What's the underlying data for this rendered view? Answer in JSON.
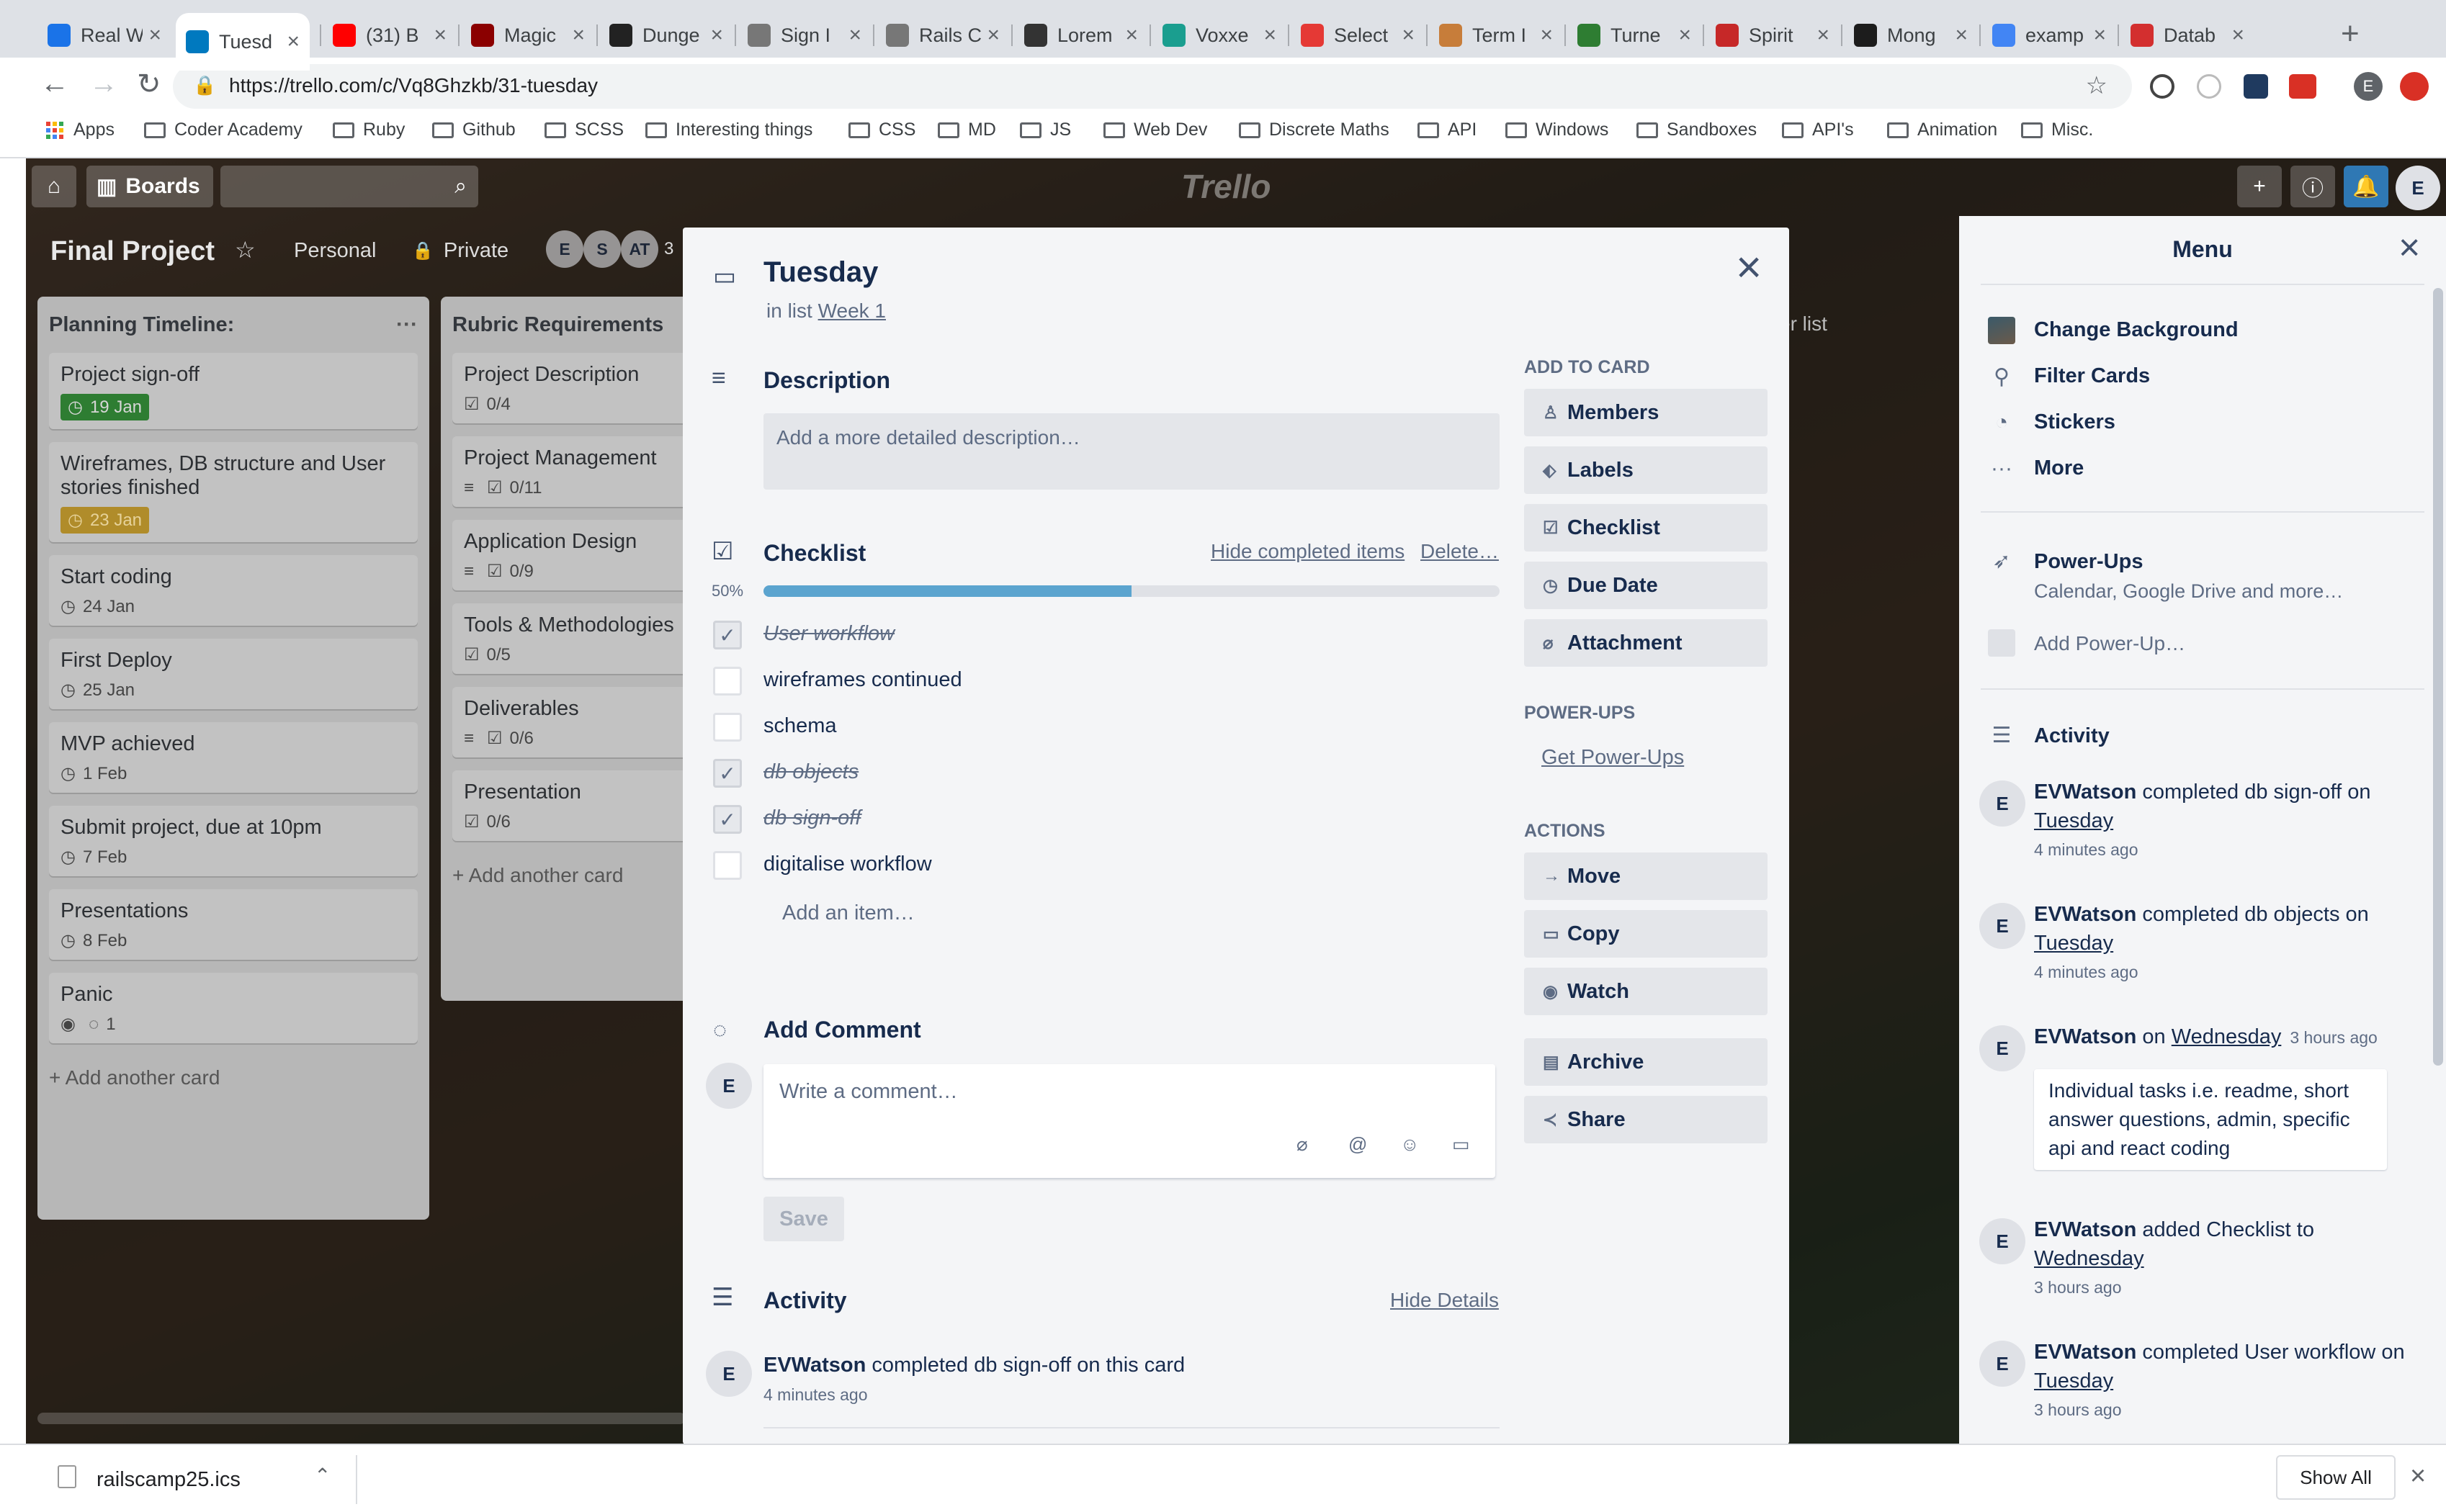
{
  "browser": {
    "tabs": [
      {
        "title": "Real W",
        "color": "#1a73e8"
      },
      {
        "title": "Tuesd",
        "color": "#0079bf",
        "active": true
      },
      {
        "title": "(31) B",
        "color": "#ff0000"
      },
      {
        "title": "Magic",
        "color": "#8b0000"
      },
      {
        "title": "Dunge",
        "color": "#222222"
      },
      {
        "title": "Sign I",
        "color": "#777777"
      },
      {
        "title": "Rails C",
        "color": "#777777"
      },
      {
        "title": "Lorem",
        "color": "#333333"
      },
      {
        "title": "Voxxe",
        "color": "#1a9e8f"
      },
      {
        "title": "Select",
        "color": "#e53935"
      },
      {
        "title": "Term I",
        "color": "#c77d3a"
      },
      {
        "title": "Turne",
        "color": "#2e7d32"
      },
      {
        "title": "Spirit",
        "color": "#c62828"
      },
      {
        "title": "Mong",
        "color": "#1c1c1c"
      },
      {
        "title": "examp",
        "color": "#4285f4"
      },
      {
        "title": "Datab",
        "color": "#d32f2f"
      }
    ],
    "url": "https://trello.com/c/Vq8Ghzkb/31-tuesday",
    "bookmarks": [
      "Apps",
      "Coder Academy",
      "Ruby",
      "Github",
      "SCSS",
      "Interesting things",
      "CSS",
      "MD",
      "JS",
      "Web Dev",
      "Discrete Maths",
      "API",
      "Windows",
      "Sandboxes",
      "API's",
      "Animation",
      "Misc."
    ],
    "profile_initial": "E"
  },
  "trello_header": {
    "boards_label": "Boards",
    "logo": "Trello",
    "user_initial": "E"
  },
  "board": {
    "title": "Final Project",
    "visibility_team": "Personal",
    "visibility": "Private",
    "members": [
      "E",
      "S",
      "AT"
    ],
    "member_overflow": "3",
    "add_list_partial": "er list",
    "lists": [
      {
        "title": "Planning Timeline:",
        "menu": "···",
        "cards": [
          {
            "title": "Project sign-off",
            "due": "19 Jan",
            "due_style": "done"
          },
          {
            "title": "Wireframes, DB structure and User stories finished",
            "due": "23 Jan",
            "due_style": "warn"
          },
          {
            "title": "Start coding",
            "due": "24 Jan"
          },
          {
            "title": "First Deploy",
            "due": "25 Jan"
          },
          {
            "title": "MVP achieved",
            "due": "1 Feb"
          },
          {
            "title": "Submit project, due at 10pm",
            "due": "7 Feb"
          },
          {
            "title": "Presentations",
            "due": "8 Feb"
          },
          {
            "title": "Panic",
            "comments": "1"
          }
        ],
        "add": "+ Add another card"
      },
      {
        "title": "Rubric Requirements",
        "cards": [
          {
            "title": "Project Description",
            "checklist": "0/4"
          },
          {
            "title": "Project Management",
            "checklist": "0/11"
          },
          {
            "title": "Application Design",
            "checklist": "0/9"
          },
          {
            "title": "Tools & Methodologies",
            "checklist": "0/5"
          },
          {
            "title": "Deliverables",
            "checklist": "0/6"
          },
          {
            "title": "Presentation",
            "checklist": "0/6"
          }
        ],
        "add": "+ Add another card"
      }
    ]
  },
  "card_modal": {
    "title": "Tuesday",
    "in_list_prefix": "in list",
    "list_name": "Week 1",
    "close": "×",
    "description": {
      "heading": "Description",
      "placeholder": "Add a more detailed description…"
    },
    "checklist": {
      "heading": "Checklist",
      "hide_completed": "Hide completed items",
      "delete": "Delete…",
      "percent_label": "50%",
      "progress": 0.5,
      "items": [
        {
          "text": "User workflow",
          "done": true
        },
        {
          "text": "wireframes continued",
          "done": false
        },
        {
          "text": "schema",
          "done": false
        },
        {
          "text": "db objects",
          "done": true
        },
        {
          "text": "db sign-off",
          "done": true
        },
        {
          "text": "digitalise workflow",
          "done": false
        }
      ],
      "add_item": "Add an item…"
    },
    "comment": {
      "heading": "Add Comment",
      "avatar": "E",
      "placeholder": "Write a comment…",
      "save": "Save"
    },
    "activity": {
      "heading": "Activity",
      "hide_details": "Hide Details",
      "entries": [
        {
          "user": "EVWatson",
          "text": "completed db sign-off on this card",
          "time": "4 minutes ago",
          "avatar": "E"
        }
      ]
    },
    "sidebar": {
      "add_to_card_heading": "ADD TO CARD",
      "add_to_card": [
        "Members",
        "Labels",
        "Checklist",
        "Due Date",
        "Attachment"
      ],
      "powerups_heading": "POWER-UPS",
      "get_powerups": "Get Power-Ups",
      "actions_heading": "ACTIONS",
      "actions": [
        "Move",
        "Copy",
        "Watch",
        "Archive",
        "Share"
      ]
    }
  },
  "menu": {
    "title": "Menu",
    "close": "×",
    "items": [
      "Change Background",
      "Filter Cards",
      "Stickers",
      "More"
    ],
    "powerups_title": "Power-Ups",
    "powerups_sub": "Calendar, Google Drive and more…",
    "add_powerup": "Add Power-Up…",
    "activity_heading": "Activity",
    "activity": [
      {
        "user": "EVWatson",
        "pre": "completed db sign-off on",
        "link": "Tuesday",
        "time": "4 minutes ago"
      },
      {
        "user": "EVWatson",
        "pre": "completed db objects on",
        "link": "Tuesday",
        "time": "4 minutes ago"
      },
      {
        "user": "EVWatson",
        "pre": "on",
        "link": "Wednesday",
        "time": "3 hours ago",
        "comment": "Individual tasks i.e. readme, short answer questions, admin, specific api and react coding"
      },
      {
        "user": "EVWatson",
        "pre": "added Checklist to",
        "link": "Wednesday",
        "time": "3 hours ago"
      },
      {
        "user": "EVWatson",
        "pre": "completed User workflow on",
        "link": "Tuesday",
        "time": "3 hours ago"
      }
    ]
  },
  "download_bar": {
    "file": "railscamp25.ics",
    "show_all": "Show All"
  }
}
